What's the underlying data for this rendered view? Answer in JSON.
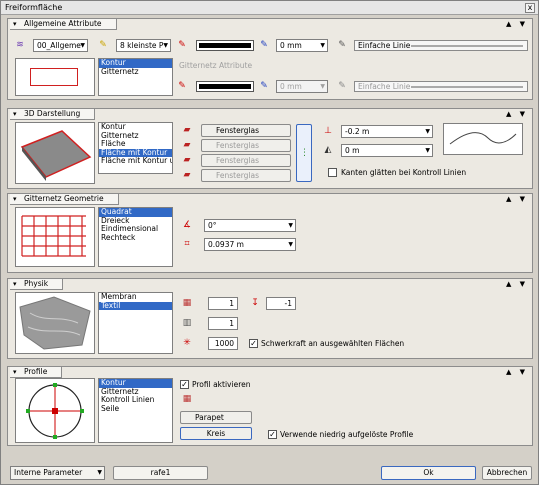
{
  "window": {
    "title": "Freiformfläche",
    "close": "x"
  },
  "panel_controls": "▲ ▼",
  "allgemein": {
    "title": "Allgemeine Attribute",
    "layer": "00_Allgeme",
    "pen": "8 kleinste P",
    "pen_width": "0 mm",
    "linetype": "Einfache Linie",
    "list": [
      "Kontur",
      "Gitternetz"
    ],
    "grid_label": "Gitternetz Attribute",
    "pen_width2": "0 mm",
    "linetype2": "Einfache Linie"
  },
  "darstellung": {
    "title": "3D Darstellung",
    "list": [
      "Kontur",
      "Gitternetz",
      "Fläche",
      "Fläche mit Kontur",
      "Fläche mit Kontur und"
    ],
    "materials": [
      "Fensterglas",
      "Fensterglas",
      "Fensterglas",
      "Fensterglas"
    ],
    "offset": "-0.2 m",
    "offset2": "0 m",
    "smooth_label": "Kanten glätten bei Kontroll Linien"
  },
  "geometrie": {
    "title": "Gitternetz Geometrie",
    "list": [
      "Quadrat",
      "Dreieck",
      "Eindimensional",
      "Rechteck"
    ],
    "angle": "0°",
    "size": "0.0937 m"
  },
  "physik": {
    "title": "Physik",
    "list": [
      "Membran",
      "Textil"
    ],
    "val1": "1",
    "val2": "-1",
    "val3": "1",
    "val4": "1000",
    "gravity_label": "Schwerkraft an ausgewählten Flächen"
  },
  "profile": {
    "title": "Profile",
    "list": [
      "Kontur",
      "Gitternetz",
      "Kontroll Linien",
      "Seile"
    ],
    "activate_label": "Profil aktivieren",
    "btn1": "Parapet",
    "btn2": "Kreis",
    "lowres_label": "Verwende niedrig aufgelöste Profile"
  },
  "footer": {
    "params": "Interne Parameter",
    "name": "rafe1",
    "ok": "Ok",
    "cancel": "Abbrechen"
  },
  "checked": "✓"
}
